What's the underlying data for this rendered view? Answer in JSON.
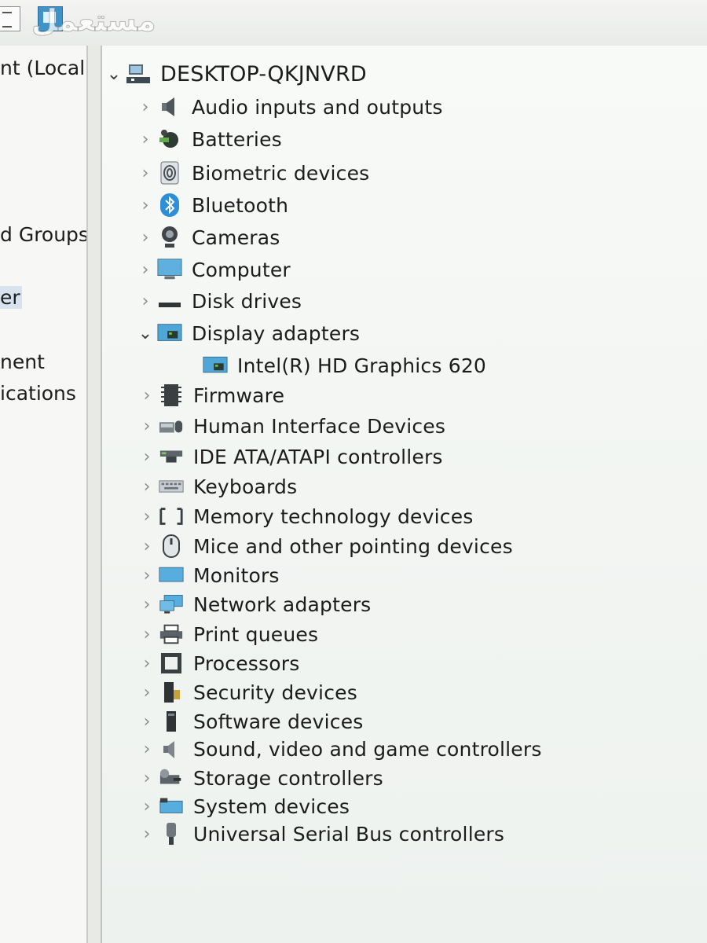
{
  "watermark": "مستعمل",
  "left_pane": {
    "items": [
      {
        "text": "nt (Local"
      },
      {
        "text": "d Groups"
      },
      {
        "text": "er"
      },
      {
        "text": "nent"
      },
      {
        "text": "ications"
      }
    ]
  },
  "tree": {
    "root": "DESKTOP-QKJNVRD",
    "categories": [
      {
        "label": "Audio inputs and outputs",
        "icon": "speaker-icon",
        "expanded": false
      },
      {
        "label": "Batteries",
        "icon": "battery-icon",
        "expanded": false
      },
      {
        "label": "Biometric devices",
        "icon": "fingerprint-icon",
        "expanded": false
      },
      {
        "label": "Bluetooth",
        "icon": "bluetooth-icon",
        "expanded": false
      },
      {
        "label": "Cameras",
        "icon": "camera-icon",
        "expanded": false
      },
      {
        "label": "Computer",
        "icon": "computer-icon",
        "expanded": false
      },
      {
        "label": "Disk drives",
        "icon": "disk-drive-icon",
        "expanded": false
      },
      {
        "label": "Display adapters",
        "icon": "display-adapter-icon",
        "expanded": true,
        "children": [
          {
            "label": "Intel(R) HD Graphics 620",
            "icon": "display-adapter-icon"
          }
        ]
      },
      {
        "label": "Firmware",
        "icon": "firmware-icon",
        "expanded": false
      },
      {
        "label": "Human Interface Devices",
        "icon": "hid-icon",
        "expanded": false
      },
      {
        "label": "IDE ATA/ATAPI controllers",
        "icon": "ide-controller-icon",
        "expanded": false
      },
      {
        "label": "Keyboards",
        "icon": "keyboard-icon",
        "expanded": false
      },
      {
        "label": "Memory technology devices",
        "icon": "memory-icon",
        "expanded": false
      },
      {
        "label": "Mice and other pointing devices",
        "icon": "mouse-icon",
        "expanded": false
      },
      {
        "label": "Monitors",
        "icon": "monitor-icon",
        "expanded": false
      },
      {
        "label": "Network adapters",
        "icon": "network-adapter-icon",
        "expanded": false
      },
      {
        "label": "Print queues",
        "icon": "printer-icon",
        "expanded": false
      },
      {
        "label": "Processors",
        "icon": "processor-icon",
        "expanded": false
      },
      {
        "label": "Security devices",
        "icon": "security-device-icon",
        "expanded": false
      },
      {
        "label": "Software devices",
        "icon": "software-device-icon",
        "expanded": false
      },
      {
        "label": "Sound, video and game controllers",
        "icon": "sound-controller-icon",
        "expanded": false
      },
      {
        "label": "Storage controllers",
        "icon": "storage-controller-icon",
        "expanded": false
      },
      {
        "label": "System devices",
        "icon": "system-devices-icon",
        "expanded": false
      },
      {
        "label": "Universal Serial Bus controllers",
        "icon": "usb-icon",
        "expanded": false
      }
    ]
  },
  "colors": {
    "accent_blue": "#3aa0d8",
    "chevron_gray": "#8b8f93",
    "selection": "#d7e4ef"
  }
}
